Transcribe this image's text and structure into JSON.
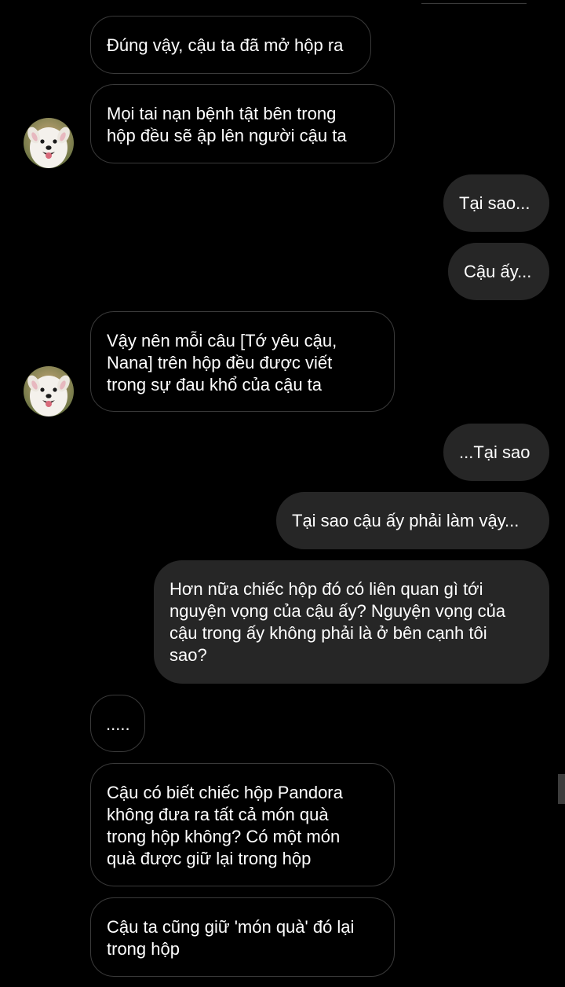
{
  "theme": {
    "background": "#000000",
    "incoming_border": "#3a3a3a",
    "outgoing_bubble": "#262626",
    "text": "#ffffff"
  },
  "contact": {
    "avatar_icon": "samoyed-dog-avatar"
  },
  "messages": [
    {
      "side": "incoming",
      "text": "Đúng vậy, cậu ta đã mở hộp ra"
    },
    {
      "side": "incoming",
      "text": "Mọi tai nạn bệnh tật bên trong\nhộp đều sẽ ập lên người cậu ta"
    },
    {
      "side": "outgoing",
      "text": "Tại sao..."
    },
    {
      "side": "outgoing",
      "text": "Cậu ấy..."
    },
    {
      "side": "incoming",
      "text": "Vậy nên mỗi câu [Tớ yêu cậu,\nNana] trên hộp đều được viết\ntrong sự đau khổ của cậu ta"
    },
    {
      "side": "outgoing",
      "text": "...Tại sao"
    },
    {
      "side": "outgoing",
      "text": "Tại sao cậu ấy phải làm vậy..."
    },
    {
      "side": "outgoing",
      "text": "Hơn nữa chiếc hộp đó có liên quan gì tới\nnguyện vọng của cậu ấy? Nguyện vọng của\ncậu trong ấy không phải là ở bên cạnh tôi\nsao?"
    },
    {
      "side": "incoming",
      "text": "....."
    },
    {
      "side": "incoming",
      "text": "Cậu có biết chiếc hộp Pandora\nkhông đưa ra tất cả món quà\ntrong hộp không? Có một món\nquà được giữ lại trong hộp"
    },
    {
      "side": "incoming",
      "text": "Cậu ta cũng giữ 'món quà' đó lại\ntrong hộp"
    }
  ]
}
